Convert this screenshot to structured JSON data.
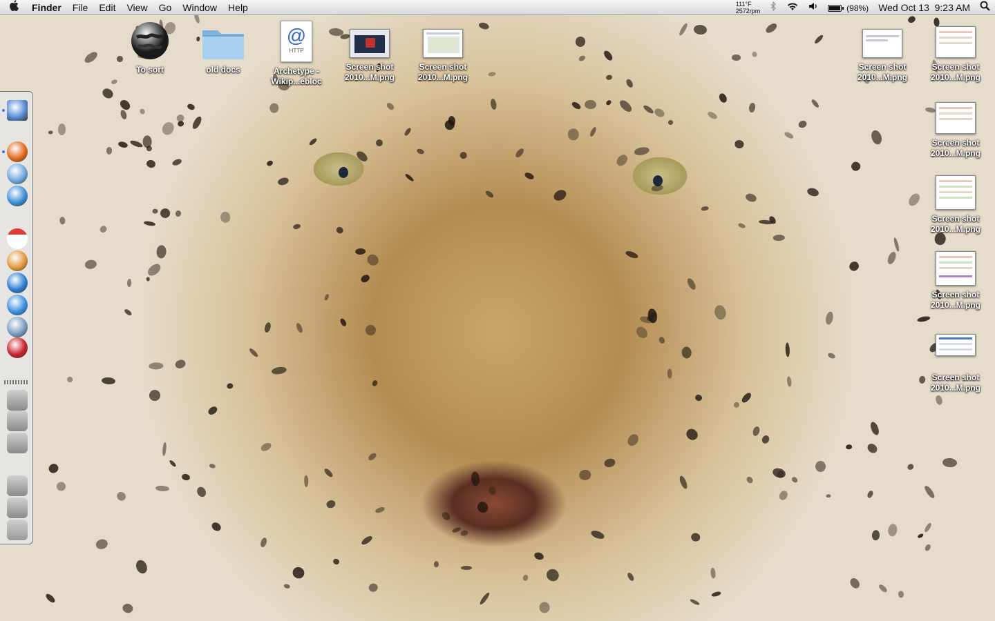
{
  "menubar": {
    "apple_icon": "apple-icon",
    "app_name": "Finder",
    "menus": [
      "File",
      "Edit",
      "View",
      "Go",
      "Window",
      "Help"
    ],
    "temperature": "111°F",
    "fan_speed": "2572rpm",
    "battery_percent": "(98%)",
    "battery_level": 0.98,
    "datetime": "Wed Oct 13  9:23 AM"
  },
  "desktop_icons": [
    {
      "label_line1": "To sort",
      "label_line2": "",
      "kind": "globe"
    },
    {
      "label_line1": "old docs",
      "label_line2": "",
      "kind": "folder"
    },
    {
      "label_line1": "Archetype -",
      "label_line2": "Wikip...ebloc",
      "kind": "webloc"
    },
    {
      "label_line1": "Screen shot",
      "label_line2": "2010...M.png",
      "kind": "screenshot"
    },
    {
      "label_line1": "Screen shot",
      "label_line2": "2010...M.png",
      "kind": "screenshot"
    },
    {
      "label_line1": "Screen shot",
      "label_line2": "2010...M.png",
      "kind": "screenshot"
    },
    {
      "label_line1": "Screen shot",
      "label_line2": "2010...M.png",
      "kind": "screenshot"
    },
    {
      "label_line1": "Screen shot",
      "label_line2": "2010...M.png",
      "kind": "screenshot"
    },
    {
      "label_line1": "Screen shot",
      "label_line2": "2010...M.png",
      "kind": "screenshot"
    },
    {
      "label_line1": "Screen shot",
      "label_line2": "2010...M.png",
      "kind": "screenshot"
    },
    {
      "label_line1": "Screen shot",
      "label_line2": "2010...M.png",
      "kind": "screenshot"
    }
  ],
  "webloc_badge": "HTTP",
  "dock_items": [
    {
      "name": "finder-icon",
      "color": "#5a8fd8"
    },
    {
      "name": "firefox-icon",
      "color": "#e06a1c"
    },
    {
      "name": "itunes-icon",
      "color": "#6fa8dc"
    },
    {
      "name": "textwrangler-icon",
      "color": "#3c8fd6"
    },
    {
      "name": "ical-icon",
      "color": "#e23b3b"
    },
    {
      "name": "iphoto-icon",
      "color": "#e39a3b"
    },
    {
      "name": "downloader-icon",
      "color": "#2e7fd3"
    },
    {
      "name": "safari-icon",
      "color": "#3a8fe0"
    },
    {
      "name": "preview-icon",
      "color": "#7a9bc2"
    },
    {
      "name": "photo-booth-icon",
      "color": "#c8222a"
    },
    {
      "name": "applications-stack-icon",
      "color": "#8a8a8a"
    },
    {
      "name": "utilities-stack-icon",
      "color": "#8a8a8a"
    },
    {
      "name": "network-stack-icon",
      "color": "#8a8a8a"
    },
    {
      "name": "documents-stack-icon",
      "color": "#8a8a8a"
    },
    {
      "name": "downloads-stack-icon",
      "color": "#8a8a8a"
    },
    {
      "name": "trash-icon",
      "color": "#9a9a9a"
    }
  ],
  "calendar_day": "13"
}
